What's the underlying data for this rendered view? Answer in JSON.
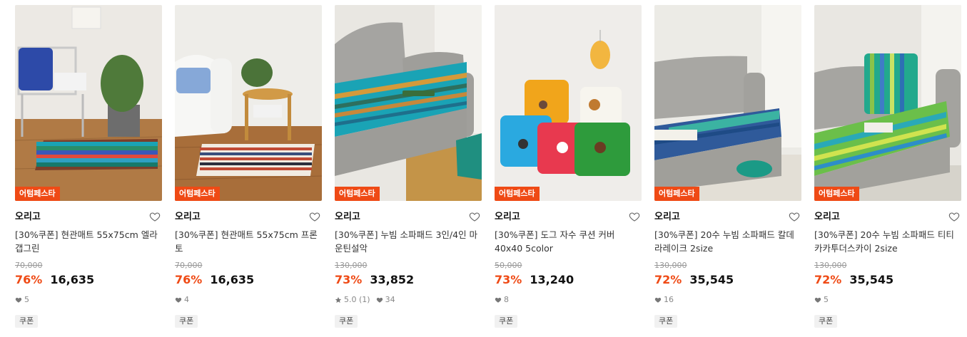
{
  "products": [
    {
      "badge": "어텀페스타",
      "brand": "오리고",
      "title": "[30%쿠폰] 현관매트 55x75cm 엘라갭그린",
      "original_price": "70,000",
      "discount": "76%",
      "price": "16,635",
      "likes": "5",
      "rating": null,
      "coupon": "쿠폰",
      "icon": "heart-icon"
    },
    {
      "badge": "어텀페스타",
      "brand": "오리고",
      "title": "[30%쿠폰] 현관매트 55x75cm 프론토",
      "original_price": "70,000",
      "discount": "76%",
      "price": "16,635",
      "likes": "4",
      "rating": null,
      "coupon": "쿠폰",
      "icon": "heart-icon"
    },
    {
      "badge": "어텀페스타",
      "brand": "오리고",
      "title": "[30%쿠폰] 누빔 소파패드 3인/4인 마운틴설악",
      "original_price": "130,000",
      "discount": "73%",
      "price": "33,852",
      "likes": "34",
      "rating": "5.0 (1)",
      "coupon": "쿠폰",
      "icon": "heart-icon"
    },
    {
      "badge": "어텀페스타",
      "brand": "오리고",
      "title": "[30%쿠폰] 도그 자수 쿠션 커버 40x40 5color",
      "original_price": "50,000",
      "discount": "73%",
      "price": "13,240",
      "likes": "8",
      "rating": null,
      "coupon": "쿠폰",
      "icon": "heart-icon"
    },
    {
      "badge": "어텀페스타",
      "brand": "오리고",
      "title": "[30%쿠폰] 20수 누빔 소파패드 칼데라레이크 2size",
      "original_price": "130,000",
      "discount": "72%",
      "price": "35,545",
      "likes": "16",
      "rating": null,
      "coupon": "쿠폰",
      "icon": "heart-icon"
    },
    {
      "badge": "어텀페스타",
      "brand": "오리고",
      "title": "[30%쿠폰] 20수 누빔 소파패드 티티카카투더스카이 2size",
      "original_price": "130,000",
      "discount": "72%",
      "price": "35,545",
      "likes": "5",
      "rating": null,
      "coupon": "쿠폰",
      "icon": "heart-icon"
    }
  ],
  "colors": {
    "accent": "#ef4a15",
    "muted": "#999999"
  }
}
